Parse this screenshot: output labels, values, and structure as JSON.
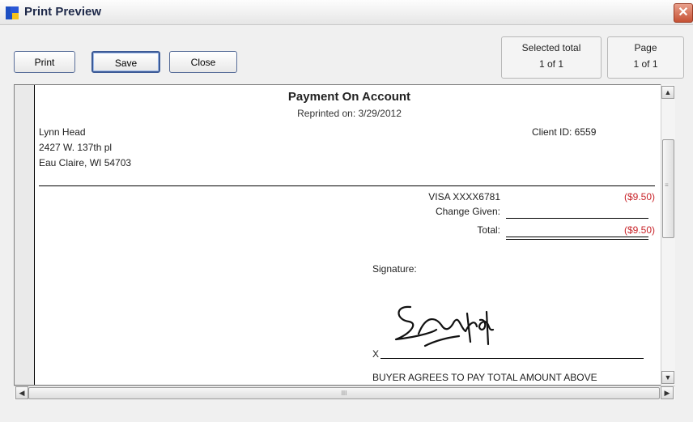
{
  "window": {
    "title": "Print Preview",
    "close_glyph": "✕"
  },
  "toolbar": {
    "print_label": "Print",
    "save_label": "Save",
    "close_label": "Close",
    "selected_total": {
      "label": "Selected total",
      "value": "1  of  1"
    },
    "page": {
      "label": "Page",
      "value": "1  of 1"
    }
  },
  "document": {
    "title": "Payment On Account",
    "reprinted": "Reprinted on: 3/29/2012",
    "client_name": "Lynn Head",
    "client_address1": "2427 W. 137th pl",
    "client_address2": "Eau Claire, WI 54703",
    "client_id": "Client ID: 6559",
    "payment_method": "VISA   XXXX6781",
    "payment_amount": "($9.50)",
    "change_label": "Change Given:",
    "total_label": "Total:",
    "total_amount": "($9.50)",
    "signature_label": "Signature:",
    "signature_x": "X",
    "buyer_agrees": "BUYER AGREES TO PAY TOTAL AMOUNT ABOVE"
  },
  "scrollbars": {
    "up": "▲",
    "down": "▼",
    "left": "◀",
    "right": "▶",
    "grip_v": "≡",
    "grip_h": "III"
  },
  "colors": {
    "amount_red": "#c8242a",
    "title_bar_close": "#c65134"
  }
}
